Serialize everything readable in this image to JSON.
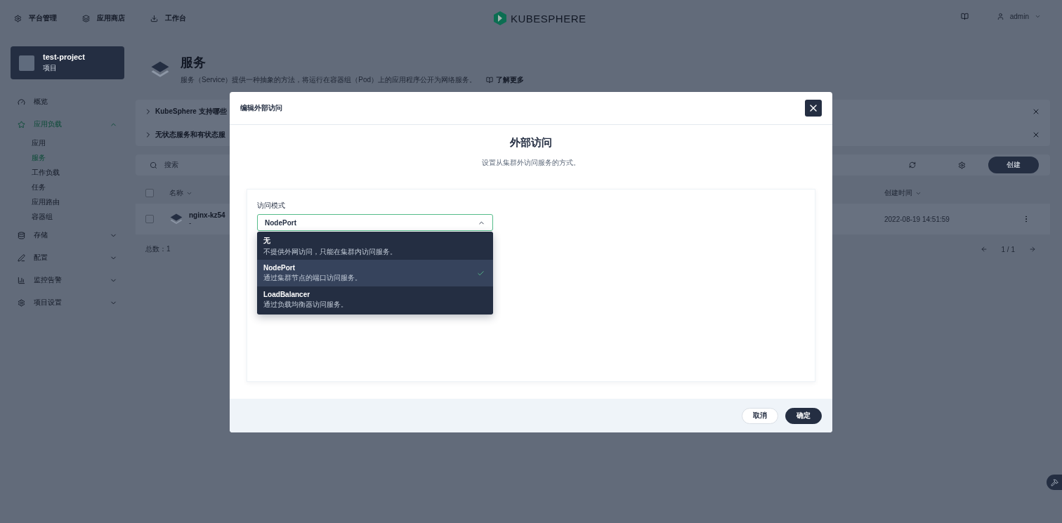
{
  "top_nav": {
    "items": [
      {
        "label": "平台管理"
      },
      {
        "label": "应用商店"
      },
      {
        "label": "工作台"
      }
    ],
    "logo": "KUBESPHERE",
    "user": "admin"
  },
  "sidebar": {
    "project": {
      "name": "test-project",
      "type": "项目"
    },
    "items": [
      {
        "label": "概览",
        "selected": false
      },
      {
        "label": "应用负载",
        "selected": true,
        "expanded": true,
        "children": [
          {
            "label": "应用",
            "selected": false
          },
          {
            "label": "服务",
            "selected": true
          },
          {
            "label": "工作负载",
            "selected": false
          },
          {
            "label": "任务",
            "selected": false
          },
          {
            "label": "应用路由",
            "selected": false
          },
          {
            "label": "容器组",
            "selected": false
          }
        ]
      },
      {
        "label": "存储",
        "selected": false,
        "expanded": false
      },
      {
        "label": "配置",
        "selected": false,
        "expanded": false
      },
      {
        "label": "监控告警",
        "selected": false,
        "expanded": false
      },
      {
        "label": "项目设置",
        "selected": false,
        "expanded": false
      }
    ]
  },
  "page_header": {
    "title": "服务",
    "description": "服务（Service）提供一种抽象的方法，将运行在容器组（Pod）上的应用程序公开为网络服务。",
    "learn_more": "了解更多"
  },
  "tips": [
    {
      "title": "KubeSphere 支持哪些"
    },
    {
      "title": "无状态服务和有状态服"
    }
  ],
  "toolbar": {
    "search_placeholder": "搜索",
    "create": "创建"
  },
  "table": {
    "select_all": {
      "checked": false
    },
    "columns": [
      {
        "label": "名称"
      },
      {
        "label": "创建时间"
      }
    ],
    "rows": [
      {
        "checked": false,
        "name": "nginx-kz54",
        "sub": "-",
        "created": "2022-08-19 14:51:59"
      }
    ],
    "total": "总数：1",
    "page": "1 / 1"
  },
  "modal": {
    "title": "编辑外部访问",
    "heading": "外部访问",
    "subheading": "设置从集群外访问服务的方式。",
    "field_label": "访问模式",
    "value": "NodePort",
    "options": [
      {
        "label": "无",
        "description": "不提供外网访问，只能在集群内访问服务。",
        "selected": false
      },
      {
        "label": "NodePort",
        "description": "通过集群节点的端口访问服务。",
        "selected": true
      },
      {
        "label": "LoadBalancer",
        "description": "通过负载均衡器访问服务。",
        "selected": false
      }
    ],
    "cancel": "取消",
    "ok": "确定"
  }
}
